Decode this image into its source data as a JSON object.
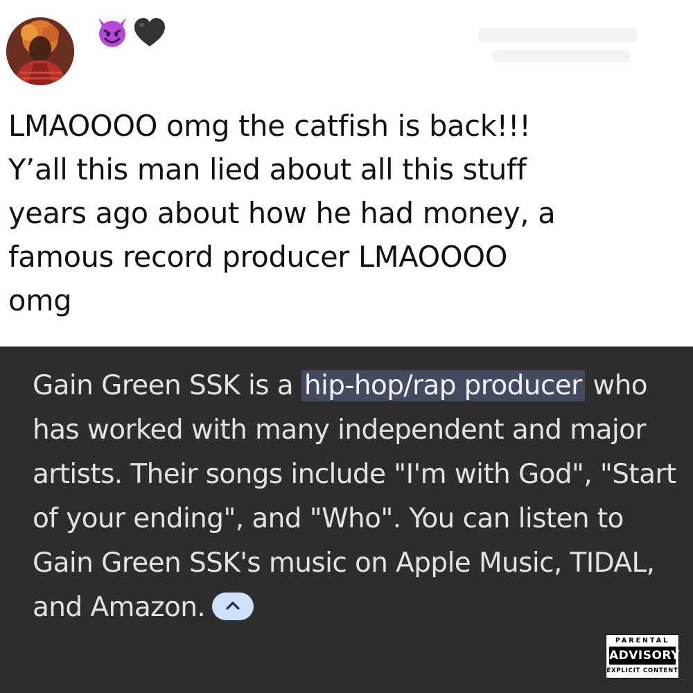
{
  "post": {
    "author_emojis": [
      "😈",
      "🖤"
    ],
    "text": "LMAOOOO omg the catfish is back!!!\nY’all this man lied about all this stuff\nyears ago about how he had money, a\nfamous record producer LMAOOOO\nomg"
  },
  "snippet": {
    "part1": "Gain Green SSK is a ",
    "highlight": "hip-hop/rap producer",
    "part2": " who has worked with many independent and major artists. Their songs include \"I'm with God\", \"Start of your ending\", and \"Who\". You can listen to Gain Green SSK's music on Apple Music, TIDAL, and Amazon.",
    "collapse_icon": "chevron-up-icon"
  },
  "advisory": {
    "top": "PARENTAL",
    "middle": "ADVISORY",
    "bottom": "EXPLICIT CONTENT"
  },
  "colors": {
    "snippet_bg": "#2d2d2f",
    "highlight_bg": "#454b5e",
    "chevron_btn": "#cfe0fb",
    "text_dark": "#111111"
  }
}
